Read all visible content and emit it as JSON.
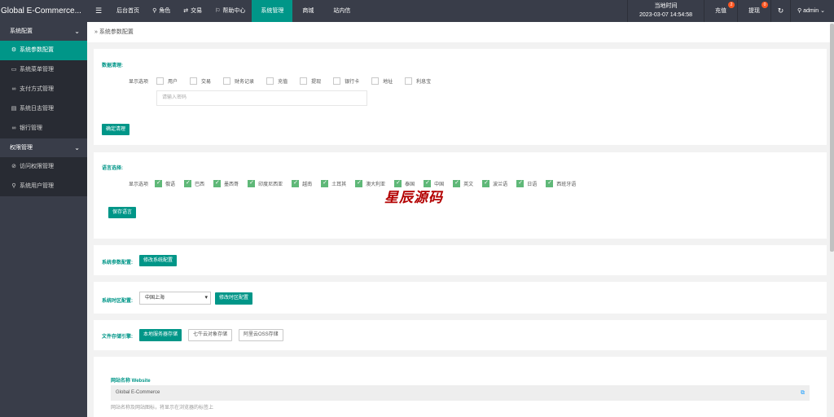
{
  "header": {
    "app_title": "Global E-Commerce...",
    "menu_icon": "hamburger-icon",
    "nav": [
      {
        "label": "后台首页",
        "icon": ""
      },
      {
        "label": "角色",
        "icon": "user-icon"
      },
      {
        "label": "交易",
        "icon": "exchange-icon"
      },
      {
        "label": "帮助中心",
        "icon": "flag-icon"
      },
      {
        "label": "系统管理",
        "icon": ""
      },
      {
        "label": "商城",
        "icon": ""
      },
      {
        "label": "站内信",
        "icon": ""
      }
    ],
    "time_label": "当地时间",
    "time_value": "2023-03-07 14:54:58",
    "recharge_label": "充值",
    "recharge_badge": "2",
    "withdraw_label": "提现",
    "withdraw_badge": "0",
    "refresh_icon": "refresh-icon",
    "user": "admin"
  },
  "sidebar": {
    "groups": [
      {
        "label": "系统配置",
        "items": [
          {
            "label": "系统参数配置",
            "icon": "gear-icon"
          },
          {
            "label": "系统菜单管理",
            "icon": "window-icon"
          },
          {
            "label": "支付方式管理",
            "icon": "link-icon"
          },
          {
            "label": "系统日志管理",
            "icon": "document-icon"
          },
          {
            "label": "银行管理",
            "icon": "link-icon"
          }
        ]
      },
      {
        "label": "权限管理",
        "items": [
          {
            "label": "访问权限管理",
            "icon": "check-circle-icon"
          },
          {
            "label": "系统用户管理",
            "icon": "user-icon"
          }
        ]
      }
    ]
  },
  "breadcrumb": "系统参数配置",
  "data_clean": {
    "title": "数据清理:",
    "row_label": "显示选项",
    "options": [
      "用户",
      "交易",
      "财务记录",
      "充值",
      "提现",
      "银行卡",
      "地址",
      "利息宝"
    ],
    "password_placeholder": "请输入密码",
    "button": "确定清理"
  },
  "language": {
    "title": "语言选择:",
    "row_label": "显示选项",
    "options": [
      "俄语",
      "巴西",
      "墨西哥",
      "印度尼西亚",
      "越南",
      "土耳其",
      "澳大利亚",
      "泰国",
      "中国",
      "英文",
      "波兰语",
      "日语",
      "西班牙语"
    ],
    "button": "保存语言"
  },
  "watermark": "星辰源码",
  "system_params": {
    "title": "系统参数配置:",
    "button": "修改系统配置"
  },
  "timezone": {
    "title": "系统时区配置:",
    "selected": "中国上海",
    "button": "修改时区配置"
  },
  "storage": {
    "title": "文件存储引擎:",
    "options": [
      "本地服务器存储",
      "七牛云对象存储",
      "阿里云OSS存储"
    ]
  },
  "website": {
    "label": "网站名称 Website",
    "value": "Global E-Commerce",
    "hint": "网站名称及网站图标，将显示在浏览器的标签上"
  },
  "colors": {
    "accent": "#009688",
    "sidebar": "#393d49",
    "checkbox_on": "#5fb878",
    "badge": "#ff5722"
  }
}
